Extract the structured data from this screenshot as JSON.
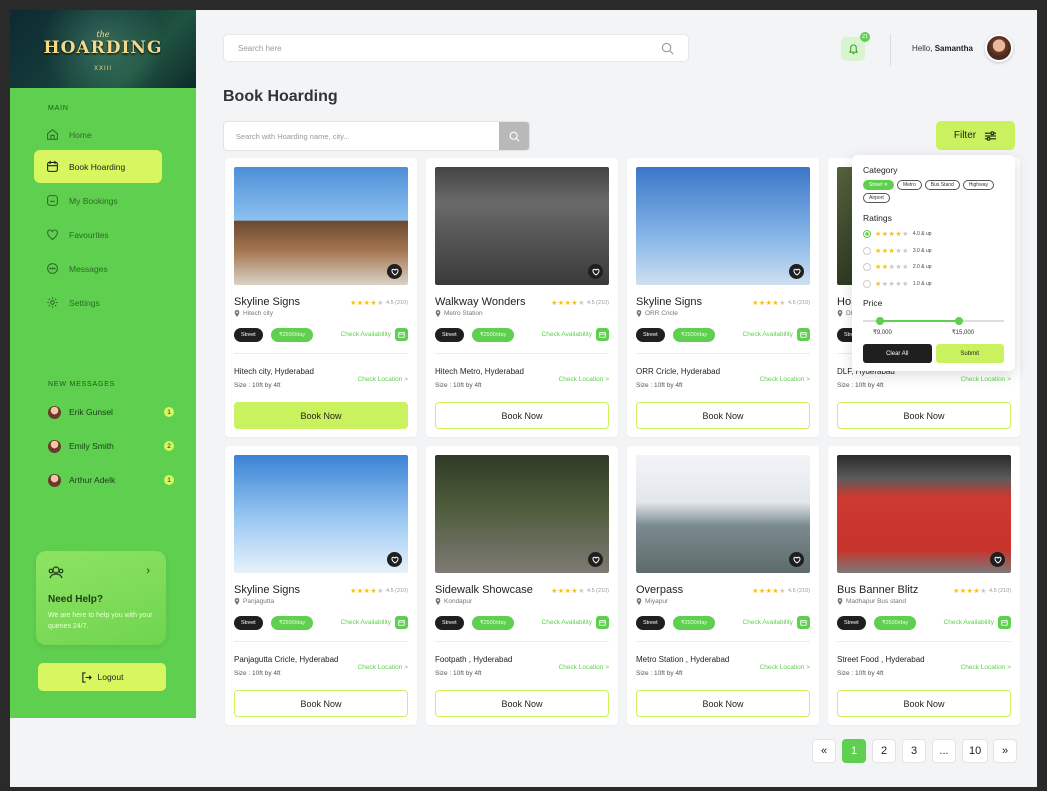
{
  "brand": {
    "logo_sub": "the",
    "logo_main": "HOARDING",
    "logo_num": "XXIII"
  },
  "sidebar": {
    "main_label": "MAIN",
    "items": [
      {
        "label": "Home",
        "icon": "home-icon"
      },
      {
        "label": "Book Hoarding",
        "icon": "calendar-icon",
        "active": true
      },
      {
        "label": "My Bookings",
        "icon": "bookings-icon"
      },
      {
        "label": "Favourites",
        "icon": "heart-icon"
      },
      {
        "label": "Messages",
        "icon": "chat-icon"
      },
      {
        "label": "Settings",
        "icon": "gear-icon"
      }
    ],
    "messages_label": "NEW MESSAGES",
    "messages": [
      {
        "name": "Erik Gunsel",
        "count": "1"
      },
      {
        "name": "Emily Smith",
        "count": "2"
      },
      {
        "name": "Arthur Adelk",
        "count": "1"
      }
    ],
    "help": {
      "title": "Need Help?",
      "text": "We are here to help you with your queries 24/7."
    },
    "logout": "Logout"
  },
  "header": {
    "search_placeholder": "Search here",
    "notifications": "21",
    "greeting": "Hello,",
    "user": "Samantha"
  },
  "main": {
    "title": "Book Hoarding",
    "search_placeholder": "Search with Hoarding name, city...",
    "filter_label": "Filter"
  },
  "card_labels": {
    "tag": "Street",
    "price": "₹2500/day",
    "check_availability": "Check Availability",
    "check_location": "Check Location >",
    "book_now": "Book Now"
  },
  "cards": [
    {
      "title": "Skyline Signs",
      "rating": "4.5 (210)",
      "location": "Hitech city",
      "address": "Hitech city, Hyderabad",
      "size": "Size : 10ft by 4ft"
    },
    {
      "title": "Walkway Wonders",
      "rating": "4.5 (210)",
      "location": "Metro Station",
      "address": "Hitech Metro, Hyderabad",
      "size": "Size : 10ft by 4ft"
    },
    {
      "title": "Skyline Signs",
      "rating": "4.5 (210)",
      "location": "ORR Cricle",
      "address": "ORR Cricle, Hyderabad",
      "size": "Size : 10ft by 4ft"
    },
    {
      "title": "Ho",
      "rating": "",
      "location": "DI",
      "address": "DLF, Hyderabad",
      "size": "Size : 10ft by 4ft"
    },
    {
      "title": "Skyline Signs",
      "rating": "4.5 (210)",
      "location": "Panjagutta",
      "address": "Panjagutta Cricle, Hyderabad",
      "size": "Size : 10ft by 4ft"
    },
    {
      "title": "Sidewalk Showcase",
      "rating": "4.5 (210)",
      "location": "Kondapur",
      "address": "Footpath , Hyderabad",
      "size": "Size : 10ft by 4ft"
    },
    {
      "title": "Overpass",
      "rating": "4.5 (210)",
      "location": "Miyapur",
      "address": "Metro Station , Hyderabad",
      "size": "Size : 10ft by 4ft"
    },
    {
      "title": "Bus Banner Blitz",
      "rating": "4.5 (210)",
      "location": "Madhapur Bus stand",
      "address": "Street Food , Hyderabad",
      "size": "Size : 10ft by 4ft"
    }
  ],
  "filter": {
    "category_title": "Category",
    "categories": [
      "Street",
      "Metro",
      "Bus Stand",
      "Highway",
      "Airport"
    ],
    "ratings_title": "Ratings",
    "ratings": [
      "4.0 & up",
      "3.0 & up",
      "2.0 & up",
      "1.0 & up"
    ],
    "price_title": "Price",
    "price_min": "₹9,000",
    "price_max": "₹15,000",
    "clear": "Clear All",
    "submit": "Submit"
  },
  "pagination": {
    "prev": "«",
    "pages": [
      "1",
      "2",
      "3",
      "...",
      "10"
    ],
    "next": "»",
    "current": "1"
  },
  "colors": {
    "primary_green": "#5fcf4f",
    "lime": "#c9f25e",
    "dark": "#1f1f1f"
  }
}
